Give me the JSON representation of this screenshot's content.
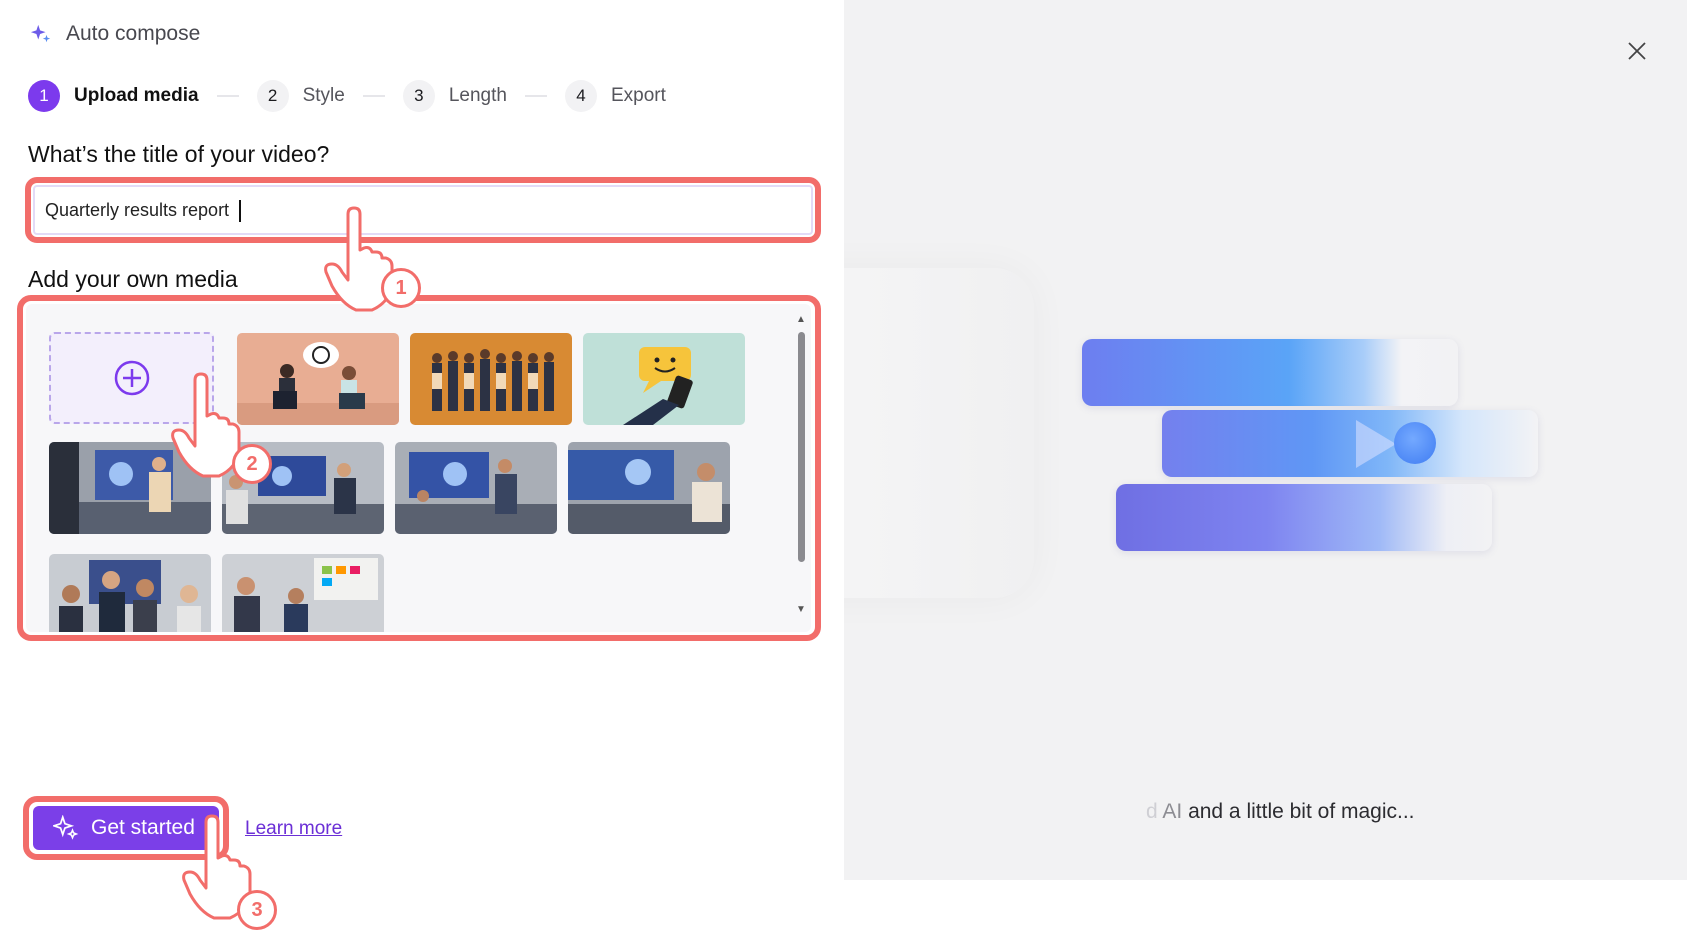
{
  "app": {
    "title": "Auto compose"
  },
  "stepper": [
    {
      "num": "1",
      "label": "Upload media",
      "active": true
    },
    {
      "num": "2",
      "label": "Style",
      "active": false
    },
    {
      "num": "3",
      "label": "Length",
      "active": false
    },
    {
      "num": "4",
      "label": "Export",
      "active": false
    }
  ],
  "form": {
    "title_heading": "What’s the title of your video?",
    "title_value": "Quarterly results report",
    "media_heading": "Add your own media"
  },
  "media": {
    "add_label": "+",
    "thumbnails": [
      "conversation-illustration",
      "team-lineup-illustration",
      "chat-smile-illustration",
      "office-presentation-1",
      "office-presentation-2",
      "office-presentation-3",
      "office-presentation-4",
      "office-team-photo-1",
      "office-team-photo-2"
    ]
  },
  "actions": {
    "get_started": "Get started",
    "learn_more": "Learn more"
  },
  "preview": {
    "caption_fade1": "d",
    "caption_fade2": "AI",
    "caption_rest": "and a little bit of magic..."
  },
  "annotations": [
    "1",
    "2",
    "3"
  ],
  "colors": {
    "accent": "#7b3fe8",
    "highlight": "#f26d6a"
  }
}
